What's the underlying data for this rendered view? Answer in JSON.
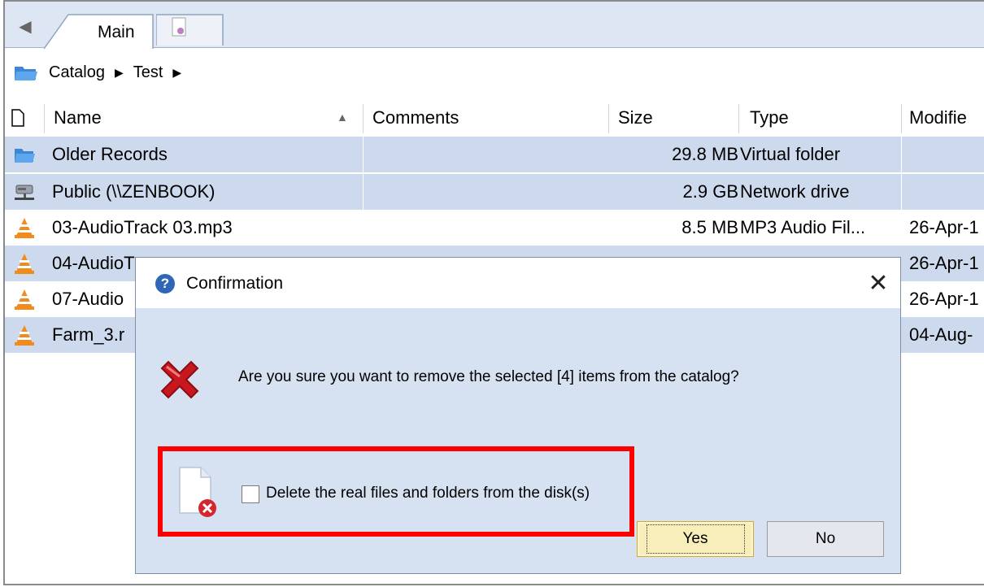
{
  "tabs": [
    {
      "label": "Main",
      "active": true
    },
    {
      "label": "",
      "icon": "disk-icon"
    }
  ],
  "breadcrumb": {
    "icon": "folder-icon",
    "items": [
      "Catalog",
      "Test"
    ]
  },
  "columns": [
    "Name",
    "Comments",
    "Size",
    "Type",
    "Modifie"
  ],
  "sort": {
    "column": "Name",
    "direction": "ascending"
  },
  "rows": [
    {
      "name": "Older Records",
      "comments": "",
      "size": "29.8 MB",
      "type": "Virtual folder",
      "modified": "",
      "icon": "virtual-folder-icon",
      "selected": true
    },
    {
      "name": "Public (\\\\ZENBOOK)",
      "comments": "",
      "size": "2.9 GB",
      "type": "Network drive",
      "modified": "",
      "icon": "network-drive-icon",
      "selected": true
    },
    {
      "name": "03-AudioTrack 03.mp3",
      "comments": "",
      "size": "8.5 MB",
      "type": "MP3 Audio Fil...",
      "modified": "26-Apr-1",
      "icon": "vlc-icon",
      "selected": false
    },
    {
      "name": "04-AudioT",
      "comments": "",
      "size": "",
      "type": "",
      "modified": "26-Apr-1",
      "icon": "vlc-icon",
      "selected": true
    },
    {
      "name": "07-Audio",
      "comments": "",
      "size": "",
      "type": "",
      "modified": "26-Apr-1",
      "icon": "vlc-icon",
      "selected": false
    },
    {
      "name": "Farm_3.r",
      "comments": "",
      "size": "",
      "type": "",
      "modified": "04-Aug-",
      "icon": "vlc-icon",
      "selected": true
    }
  ],
  "dialog": {
    "title": "Confirmation",
    "message": "Are you sure you want to remove the selected [4] items from the catalog?",
    "checkbox_label": "Delete the real files and folders from the disk(s)",
    "checkbox_checked": false,
    "yes_label": "Yes",
    "no_label": "No",
    "close_glyph": "✕"
  },
  "colors": {
    "selection": "#cdd9ec",
    "highlight_box": "#ff0000",
    "dialog_bg": "#d6e2f1"
  }
}
